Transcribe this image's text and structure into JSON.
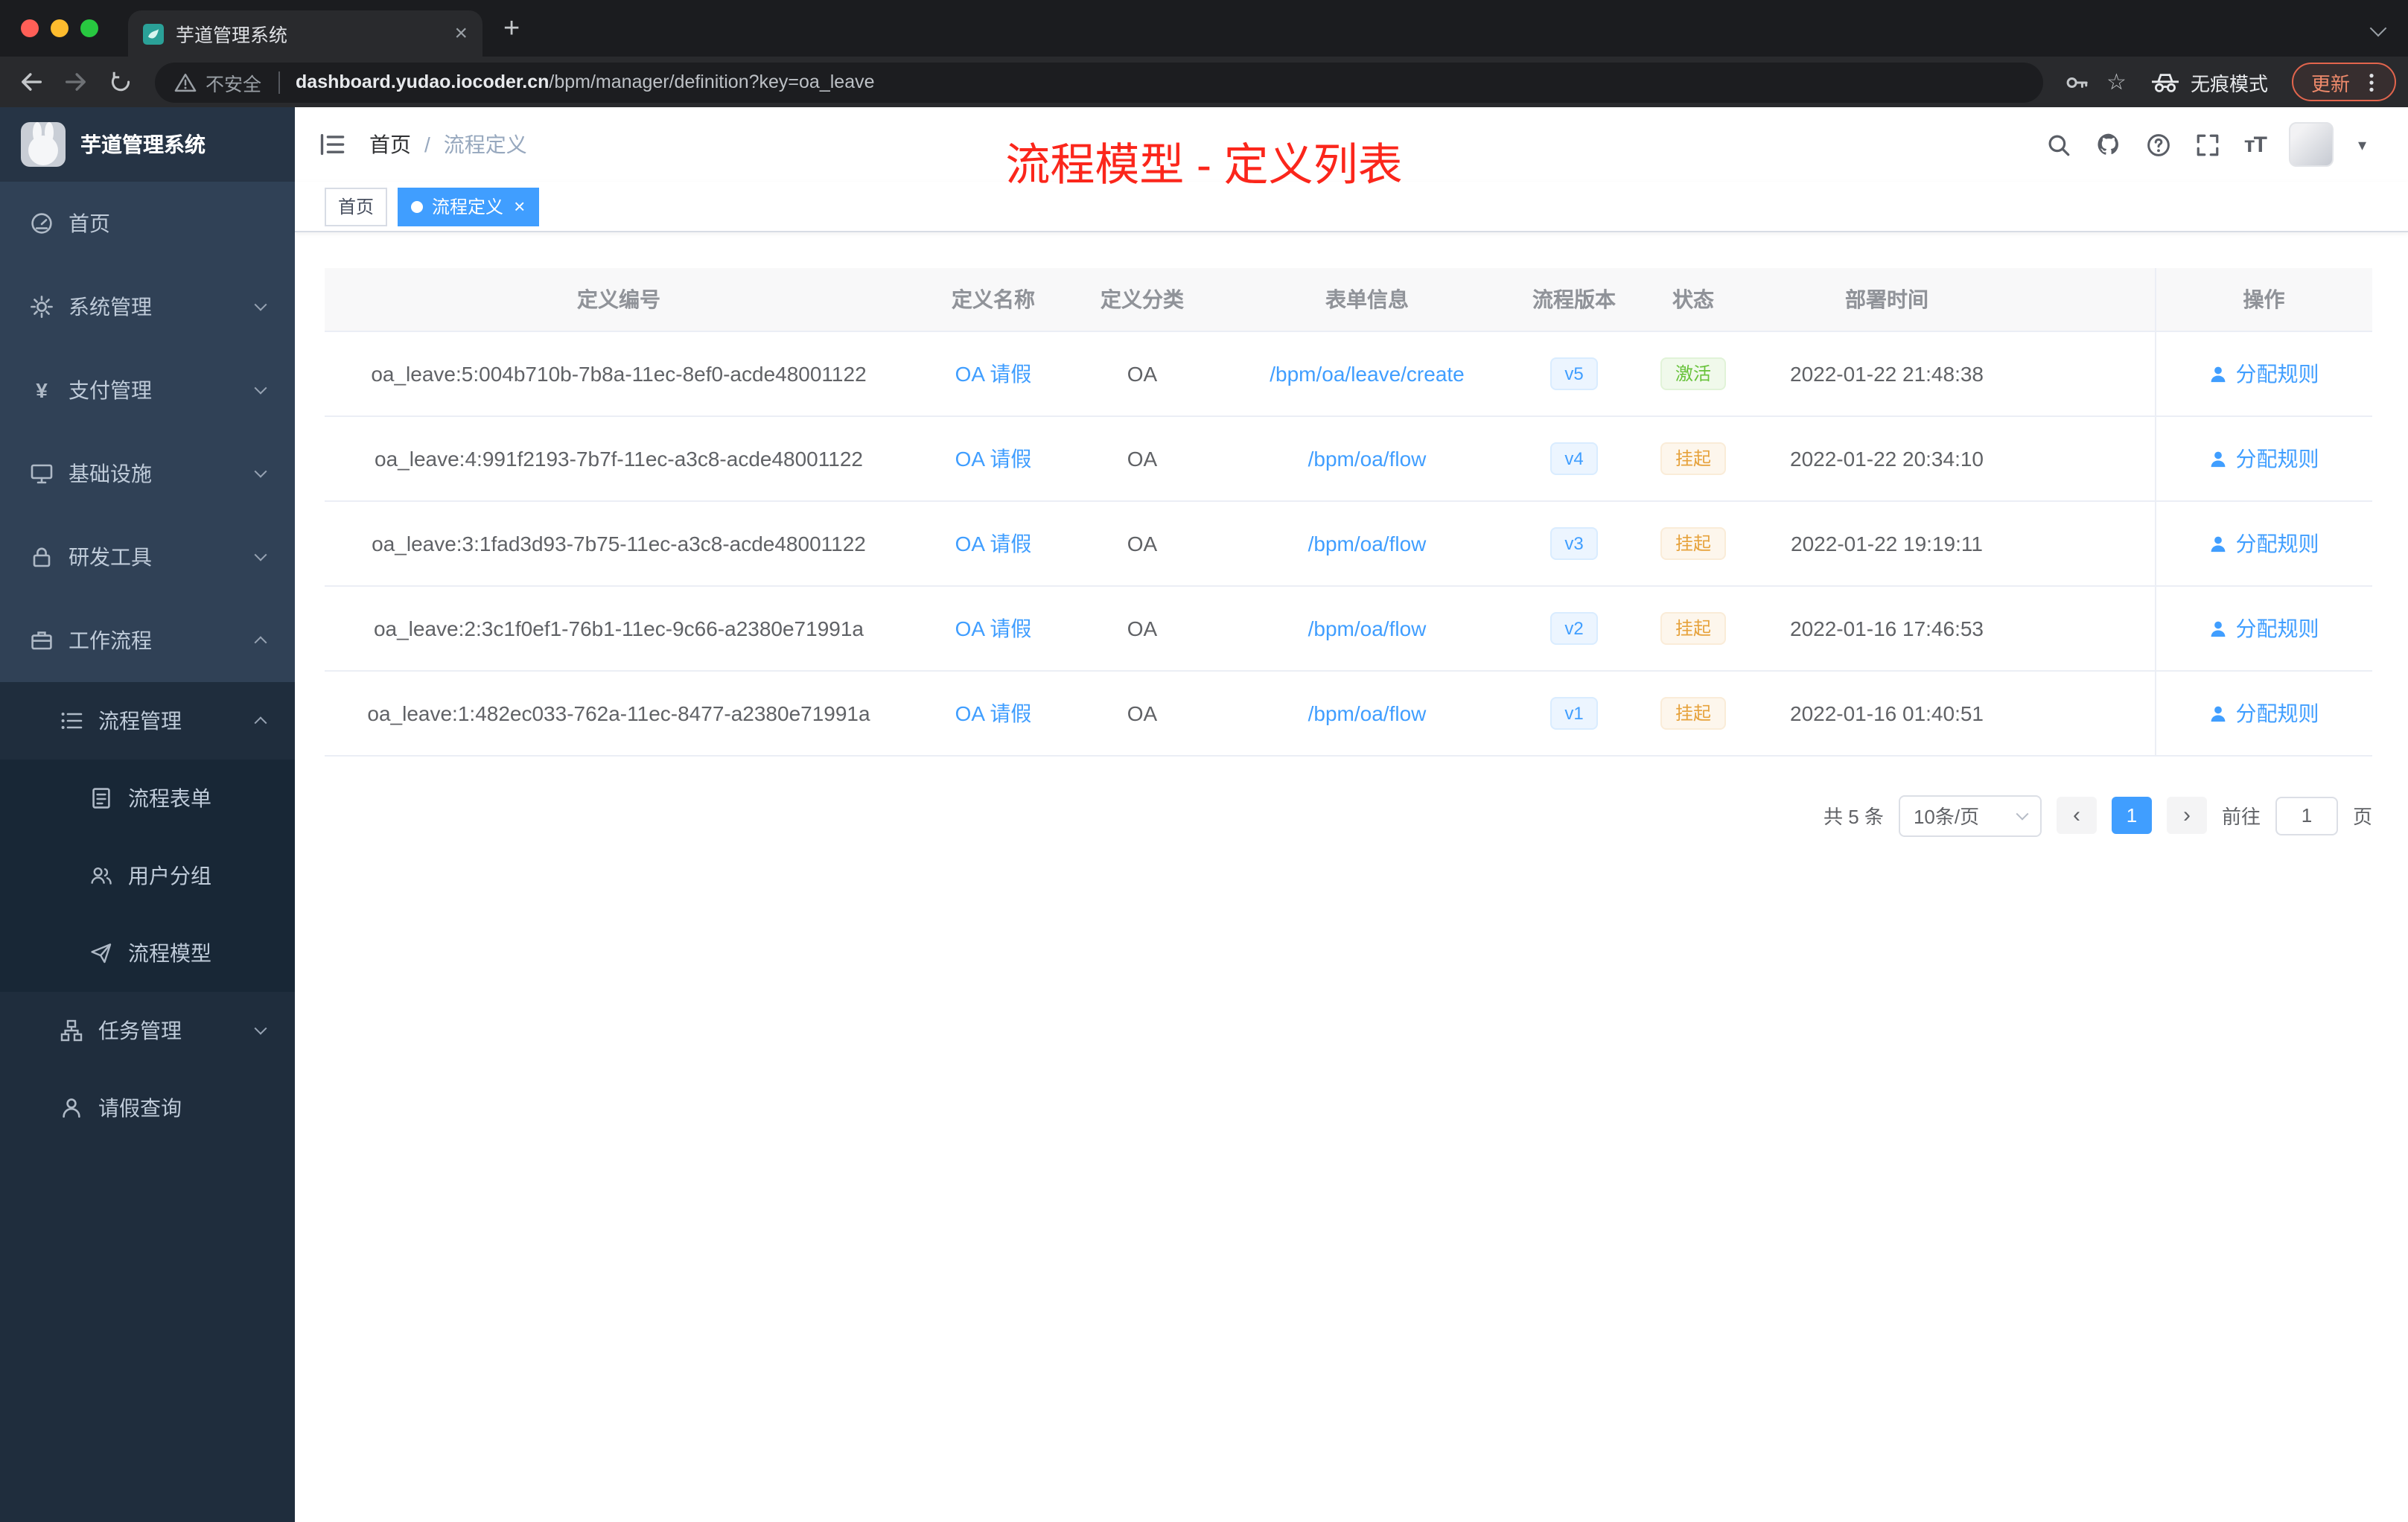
{
  "colors": {
    "accent_blue": "#409eff",
    "sidebar_bg": "#304156",
    "submenu_bg": "#1f2d3d",
    "status_active_green": "#67c23a",
    "status_suspended_orange": "#e6a23c",
    "annotation_red": "#fb261b",
    "update_pill_orange": "#e2654d"
  },
  "icons": {
    "tab_close": "×",
    "new_tab": "+",
    "star": "☆",
    "prev_page": "‹",
    "next_page": "›",
    "yen": "¥",
    "font_size": "тT",
    "caret_down": "▾"
  },
  "browser": {
    "tab_title": "芋道管理系统",
    "address": {
      "warning": "不安全",
      "domain": "dashboard.yudao.iocoder.cn",
      "path": "/bpm/manager/definition?key=oa_leave"
    },
    "incognito_label": "无痕模式",
    "update_label": "更新"
  },
  "sidebar": {
    "logo_title": "芋道管理系统",
    "items": [
      {
        "label": "首页"
      },
      {
        "label": "系统管理"
      },
      {
        "label": "支付管理"
      },
      {
        "label": "基础设施"
      },
      {
        "label": "研发工具"
      },
      {
        "label": "工作流程"
      },
      {
        "label": "流程管理"
      },
      {
        "label": "流程表单"
      },
      {
        "label": "用户分组"
      },
      {
        "label": "流程模型"
      },
      {
        "label": "任务管理"
      },
      {
        "label": "请假查询"
      }
    ]
  },
  "header": {
    "breadcrumb_home": "首页",
    "breadcrumb_sep": "/",
    "breadcrumb_current": "流程定义",
    "overlay_title": "流程模型 - 定义列表"
  },
  "tags": {
    "home": "首页",
    "current": "流程定义"
  },
  "table": {
    "columns": [
      "定义编号",
      "定义名称",
      "定义分类",
      "表单信息",
      "流程版本",
      "状态",
      "部署时间",
      "操作"
    ],
    "rows": [
      {
        "id": "oa_leave:5:004b710b-7b8a-11ec-8ef0-acde48001122",
        "name": "OA 请假",
        "category": "OA",
        "form": "/bpm/oa/leave/create",
        "version": "v5",
        "status": "激活",
        "time": "2022-01-22 21:48:38",
        "action": "分配规则"
      },
      {
        "id": "oa_leave:4:991f2193-7b7f-11ec-a3c8-acde48001122",
        "name": "OA 请假",
        "category": "OA",
        "form": "/bpm/oa/flow",
        "version": "v4",
        "status": "挂起",
        "time": "2022-01-22 20:34:10",
        "action": "分配规则"
      },
      {
        "id": "oa_leave:3:1fad3d93-7b75-11ec-a3c8-acde48001122",
        "name": "OA 请假",
        "category": "OA",
        "form": "/bpm/oa/flow",
        "version": "v3",
        "status": "挂起",
        "time": "2022-01-22 19:19:11",
        "action": "分配规则"
      },
      {
        "id": "oa_leave:2:3c1f0ef1-76b1-11ec-9c66-a2380e71991a",
        "name": "OA 请假",
        "category": "OA",
        "form": "/bpm/oa/flow",
        "version": "v2",
        "status": "挂起",
        "time": "2022-01-16 17:46:53",
        "action": "分配规则"
      },
      {
        "id": "oa_leave:1:482ec033-762a-11ec-8477-a2380e71991a",
        "name": "OA 请假",
        "category": "OA",
        "form": "/bpm/oa/flow",
        "version": "v1",
        "status": "挂起",
        "time": "2022-01-16 01:40:51",
        "action": "分配规则"
      }
    ]
  },
  "pagination": {
    "total": "共 5 条",
    "page_size": "10条/页",
    "current_page": "1",
    "goto_label": "前往",
    "goto_value": "1",
    "goto_unit": "页"
  }
}
